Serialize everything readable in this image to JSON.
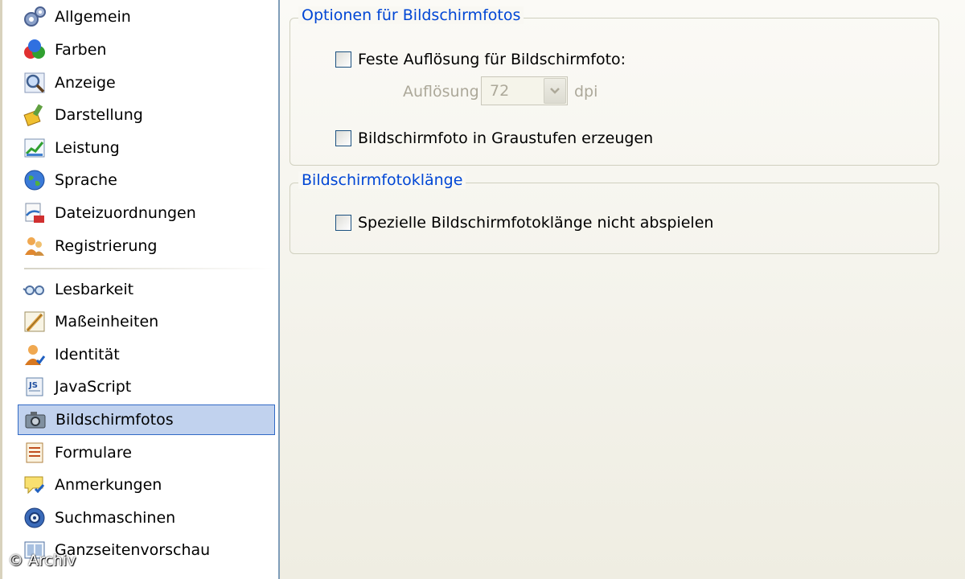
{
  "sidebar": {
    "items": [
      {
        "label": "Allgemein",
        "icon": "gears-icon"
      },
      {
        "label": "Farben",
        "icon": "color-balls-icon"
      },
      {
        "label": "Anzeige",
        "icon": "magnifier-icon"
      },
      {
        "label": "Darstellung",
        "icon": "paint-brush-icon"
      },
      {
        "label": "Leistung",
        "icon": "performance-chart-icon"
      },
      {
        "label": "Sprache",
        "icon": "globe-icon"
      },
      {
        "label": "Dateizuordnungen",
        "icon": "file-association-icon"
      },
      {
        "label": "Registrierung",
        "icon": "users-icon"
      },
      {
        "label": "Lesbarkeit",
        "icon": "eyeglasses-icon"
      },
      {
        "label": "Maßeinheiten",
        "icon": "ruler-icon"
      },
      {
        "label": "Identität",
        "icon": "identity-user-icon"
      },
      {
        "label": "JavaScript",
        "icon": "javascript-icon"
      },
      {
        "label": "Bildschirmfotos",
        "icon": "camera-icon",
        "selected": true
      },
      {
        "label": "Formulare",
        "icon": "form-icon"
      },
      {
        "label": "Anmerkungen",
        "icon": "annotation-icon"
      },
      {
        "label": "Suchmaschinen",
        "icon": "search-engine-icon"
      },
      {
        "label": "Ganzseitenvorschau",
        "icon": "page-preview-icon"
      }
    ]
  },
  "options_group": {
    "title": "Optionen für Bildschirmfotos",
    "fixed_resolution_label": "Feste Auflösung für Bildschirmfoto:",
    "fixed_resolution_checked": false,
    "resolution_label": "Auflösung",
    "resolution_value": "72",
    "resolution_unit": "dpi",
    "grayscale_label": "Bildschirmfoto in Graustufen erzeugen",
    "grayscale_checked": false
  },
  "sounds_group": {
    "title": "Bildschirmfotoklänge",
    "no_sounds_label": "Spezielle Bildschirmfotoklänge nicht abspielen",
    "no_sounds_checked": false
  },
  "watermark": "© Archiv",
  "colors": {
    "accent": "#0046d5",
    "selection_bg": "#c1d2ee",
    "selection_border": "#316ac5",
    "disabled_text": "#aca899"
  }
}
